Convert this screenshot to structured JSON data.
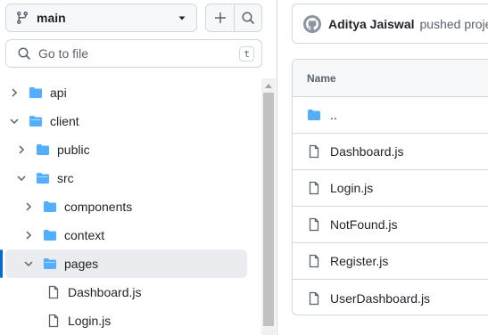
{
  "branch": {
    "name": "main"
  },
  "goto_file": {
    "placeholder": "Go to file",
    "shortcut": "t"
  },
  "tree": [
    {
      "label": "api",
      "type": "folder",
      "expanded": false,
      "depth": 0
    },
    {
      "label": "client",
      "type": "folder",
      "expanded": true,
      "depth": 0
    },
    {
      "label": "public",
      "type": "folder",
      "expanded": false,
      "depth": 1
    },
    {
      "label": "src",
      "type": "folder",
      "expanded": true,
      "depth": 1
    },
    {
      "label": "components",
      "type": "folder",
      "expanded": false,
      "depth": 2
    },
    {
      "label": "context",
      "type": "folder",
      "expanded": false,
      "depth": 2
    },
    {
      "label": "pages",
      "type": "folder",
      "expanded": true,
      "depth": 2,
      "active": true
    },
    {
      "label": "Dashboard.js",
      "type": "file",
      "depth": 3
    },
    {
      "label": "Login.js",
      "type": "file",
      "depth": 3
    }
  ],
  "commit": {
    "author": "Aditya Jaiswal",
    "message": "pushed proje"
  },
  "files_table": {
    "header": "Name",
    "rows": [
      {
        "name": "..",
        "type": "folder"
      },
      {
        "name": "Dashboard.js",
        "type": "file"
      },
      {
        "name": "Login.js",
        "type": "file"
      },
      {
        "name": "NotFound.js",
        "type": "file"
      },
      {
        "name": "Register.js",
        "type": "file"
      },
      {
        "name": "UserDashboard.js",
        "type": "file"
      }
    ]
  },
  "colors": {
    "folder": "#54aeff",
    "accent": "#0969da",
    "muted": "#59636e"
  }
}
